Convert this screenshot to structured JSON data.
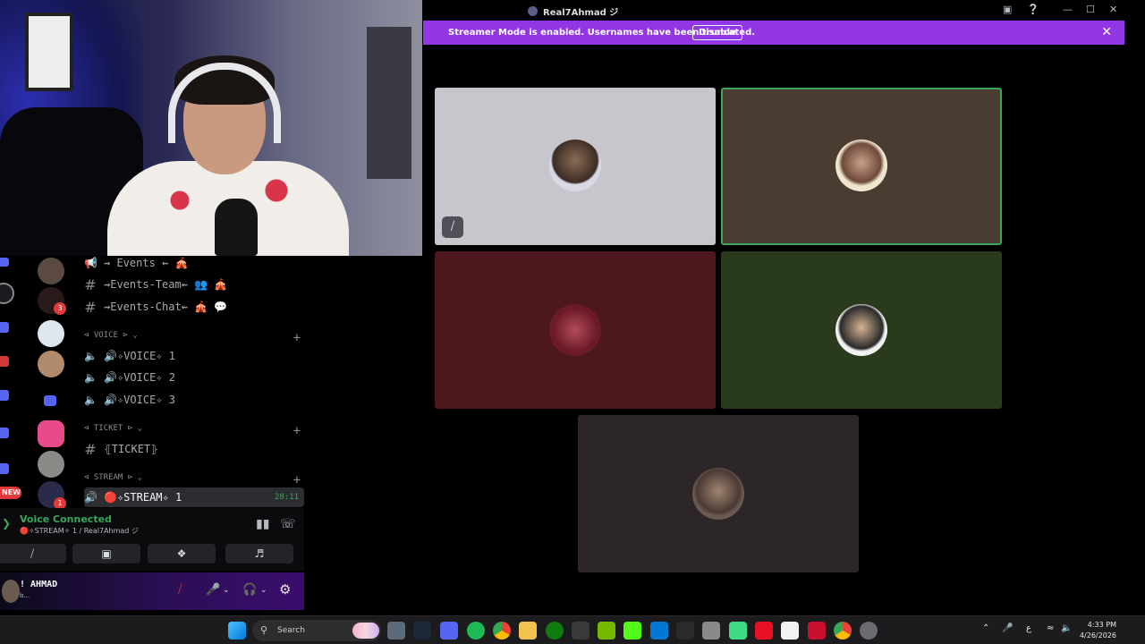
{
  "window": {
    "title": "Real7Ahmad ジ"
  },
  "banner": {
    "message": "Streamer Mode is enabled. Usernames have been truncated.",
    "disable_label": "Disable"
  },
  "rail": {
    "badges": [
      "3",
      "1"
    ],
    "new_label": "NEW"
  },
  "channels": {
    "text_top": [
      {
        "name": "⇝ Events ⇜ 🎪",
        "type": "announce"
      },
      {
        "name": "⇝Events-Team⇜ 👥 🎪",
        "type": "text"
      },
      {
        "name": "⇝Events-Chat⇜ 🎪 💬",
        "type": "text"
      }
    ],
    "voice_category": "⊲ VOICE ⊳",
    "voice": [
      "🔊✧VOICE✧ 1",
      "🔊✧VOICE✧ 2",
      "🔊✧VOICE✧ 3"
    ],
    "ticket_category": "⊲ TICKET ⊳",
    "ticket": "⦃TICKET⦄",
    "stream_category": "⊲ STREAM ⊳",
    "stream": "🔴✧STREAM✧ 1",
    "stream_timer": "28:11"
  },
  "voice_panel": {
    "title": "Voice Connected",
    "subtitle": "🔴✧STREAM✧ 1 / Real7Ahmad ジ"
  },
  "user": {
    "name": "! AHMAD",
    "status": "b..."
  },
  "taskbar": {
    "search_label": "Search",
    "clock_time": "4:33 PM",
    "clock_date": "4/26/2026",
    "lang": "ع"
  },
  "colors": {
    "streamer_banner": "#9336e6",
    "voice_green": "#3ba55c",
    "tile1_bg": "#c7c6cc",
    "tile2_bg": "#4a3c31",
    "tile3_bg": "#4d171e",
    "tile4_bg": "#2a3a1c",
    "tile5_bg": "#2c2628"
  }
}
